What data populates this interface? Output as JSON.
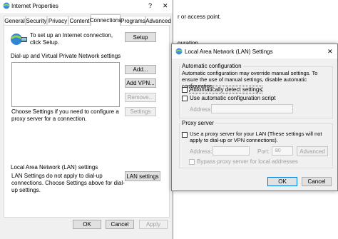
{
  "background_window": {
    "line1": "r or access point.",
    "line2": "guration."
  },
  "internet_properties": {
    "title": "Internet Properties",
    "help_glyph": "?",
    "close_glyph": "✕",
    "tabs": [
      "General",
      "Security",
      "Privacy",
      "Content",
      "Connections",
      "Programs",
      "Advanced"
    ],
    "setup_text": "To set up an Internet connection, click Setup.",
    "setup_button": "Setup",
    "dialup_header": "Dial-up and Virtual Private Network settings",
    "add_button": "Add...",
    "add_vpn_button": "Add VPN...",
    "remove_button": "Remove...",
    "settings_button": "Settings",
    "proxy_text": "Choose Settings if you need to configure a proxy server for a connection.",
    "lan_header": "Local Area Network (LAN) settings",
    "lan_text": "LAN Settings do not apply to dial-up connections. Choose Settings above for dial-up settings.",
    "lan_button": "LAN settings",
    "ok_button": "OK",
    "cancel_button": "Cancel",
    "apply_button": "Apply"
  },
  "lan_dialog": {
    "title": "Local Area Network (LAN) Settings",
    "close_glyph": "✕",
    "auto_config_header": "Automatic configuration",
    "auto_config_text": "Automatic configuration may override manual settings. To ensure the use of manual settings, disable automatic configuration.",
    "auto_detect_label": "Automatically detect settings",
    "auto_detect_checked": false,
    "use_script_label": "Use automatic configuration script",
    "use_script_checked": false,
    "address_label": "Address",
    "address_value": "",
    "proxy_header": "Proxy server",
    "use_proxy_label": "Use a proxy server for your LAN (These settings will not apply to dial-up or VPN connections).",
    "use_proxy_checked": false,
    "proxy_address_label": "Address:",
    "proxy_address_value": "",
    "port_label": "Port:",
    "port_value": "80",
    "advanced_button": "Advanced",
    "bypass_label": "Bypass proxy server for local addresses",
    "bypass_checked": false,
    "ok_button": "OK",
    "cancel_button": "Cancel"
  }
}
